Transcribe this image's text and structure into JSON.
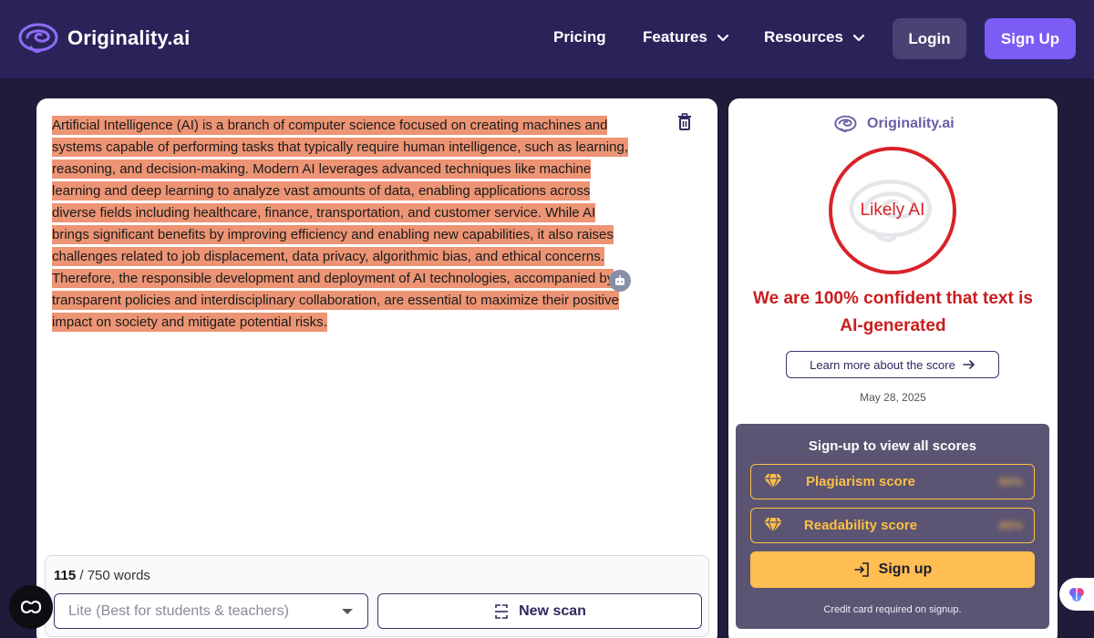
{
  "header": {
    "brand": "Originality.ai",
    "nav": [
      {
        "label": "Pricing",
        "has_dropdown": false
      },
      {
        "label": "Features",
        "has_dropdown": true
      },
      {
        "label": "Resources",
        "has_dropdown": true
      }
    ],
    "login_label": "Login",
    "signup_label": "Sign Up"
  },
  "editor": {
    "text": "Artificial Intelligence (AI) is a branch of computer science focused on creating machines and systems capable of performing tasks that typically require human intelligence, such as learning, reasoning, and decision-making. Modern AI leverages advanced techniques like machine learning and deep learning to analyze vast amounts of data, enabling applications across diverse fields including healthcare, finance, transportation, and customer service. While AI brings significant benefits by improving efficiency and enabling new capabilities, it also raises challenges related to job displacement, data privacy, algorithmic bias, and ethical concerns. Therefore, the responsible development and deployment of AI technologies, accompanied by transparent policies and interdisciplinary collaboration, are essential to maximize their positive impact on society and mitigate potential risks.",
    "word_count": "115",
    "word_limit": "750 words",
    "model_select": "Lite (Best for students & teachers)",
    "new_scan_label": "New scan",
    "highlight_color": "#ec9474"
  },
  "result": {
    "brand": "Originality.ai",
    "verdict": "Likely AI",
    "confidence_text": "We are 100% confident that text is AI-generated",
    "learn_more_label": "Learn more about the score",
    "date": "May 28, 2025",
    "verdict_color": "#d8232a"
  },
  "signup_box": {
    "title": "Sign-up to view all scores",
    "scores": [
      {
        "label": "Plagiarism score",
        "hidden_value": "80%"
      },
      {
        "label": "Readability score",
        "hidden_value": "80%"
      }
    ],
    "signup_label": "Sign up",
    "note": "Credit card required on signup."
  },
  "colors": {
    "header_bg": "#29235a",
    "page_bg": "#1f1b3a",
    "accent": "#7b5cf5",
    "gold": "#ffbe52"
  }
}
